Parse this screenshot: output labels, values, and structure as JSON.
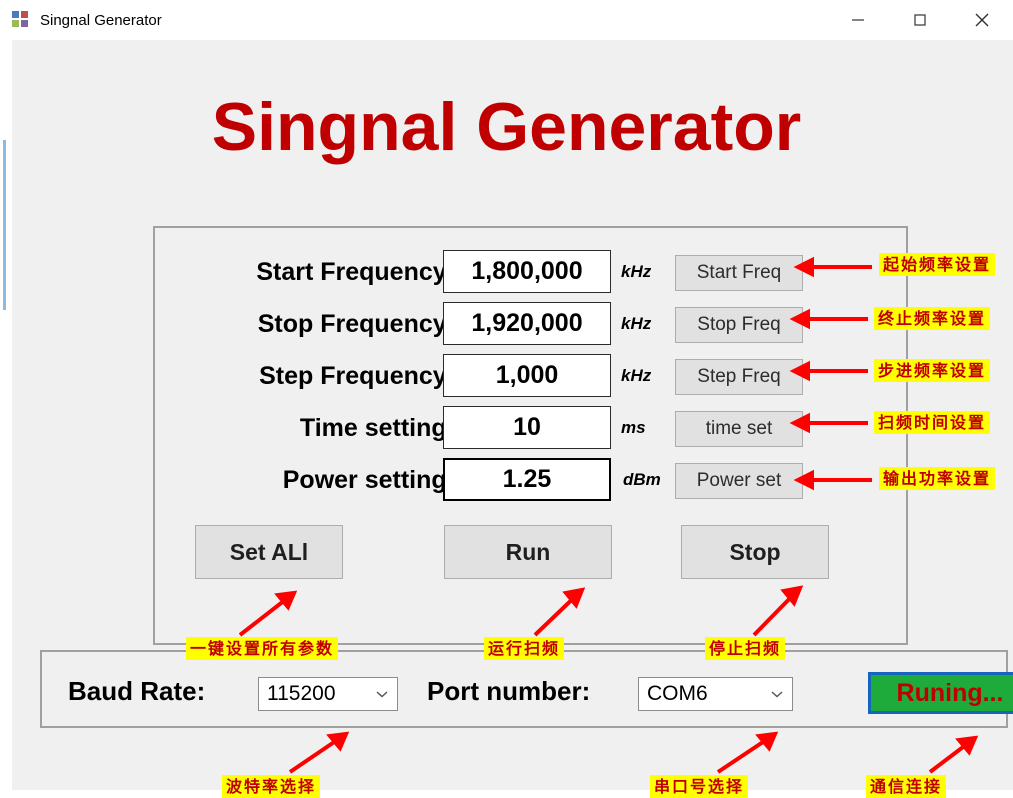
{
  "window": {
    "title": "Singnal Generator",
    "icon": "app-icon",
    "minimize": "─",
    "maximize": "□",
    "close": "✕"
  },
  "heading": "Singnal Generator",
  "colors": {
    "heading": "#C00000",
    "annotation_text": "#C00000",
    "annotation_bg": "#FFFF00",
    "status_bg": "#1FAA3C",
    "status_border": "#1565C0",
    "arrow": "#FF0000"
  },
  "form": {
    "rows": [
      {
        "label": "Start Frequency:",
        "value": "1,800,000",
        "unit": "kHz",
        "button": "Start Freq",
        "annotation": "起始频率设置"
      },
      {
        "label": "Stop Frequency:",
        "value": "1,920,000",
        "unit": "kHz",
        "button": "Stop Freq",
        "annotation": "终止频率设置"
      },
      {
        "label": "Step Frequency:",
        "value": "1,000",
        "unit": "kHz",
        "button": "Step Freq",
        "annotation": "步进频率设置"
      },
      {
        "label": "Time setting:",
        "value": "10",
        "unit": "ms",
        "button": "time set",
        "annotation": "扫频时间设置"
      },
      {
        "label": "Power setting:",
        "value": "1.25",
        "unit": "dBm",
        "button": "Power set",
        "annotation": "输出功率设置"
      }
    ],
    "actions": [
      {
        "label": "Set ALl",
        "annotation": "一键设置所有参数"
      },
      {
        "label": "Run",
        "annotation": "运行扫频"
      },
      {
        "label": "Stop",
        "annotation": "停止扫频"
      }
    ]
  },
  "bottom": {
    "baud_label": "Baud Rate:",
    "baud_value": "115200",
    "baud_annotation": "波特率选择",
    "port_label": "Port number:",
    "port_value": "COM6",
    "port_annotation": "串口号选择",
    "status_value": "Runing...",
    "status_annotation": "通信连接"
  }
}
